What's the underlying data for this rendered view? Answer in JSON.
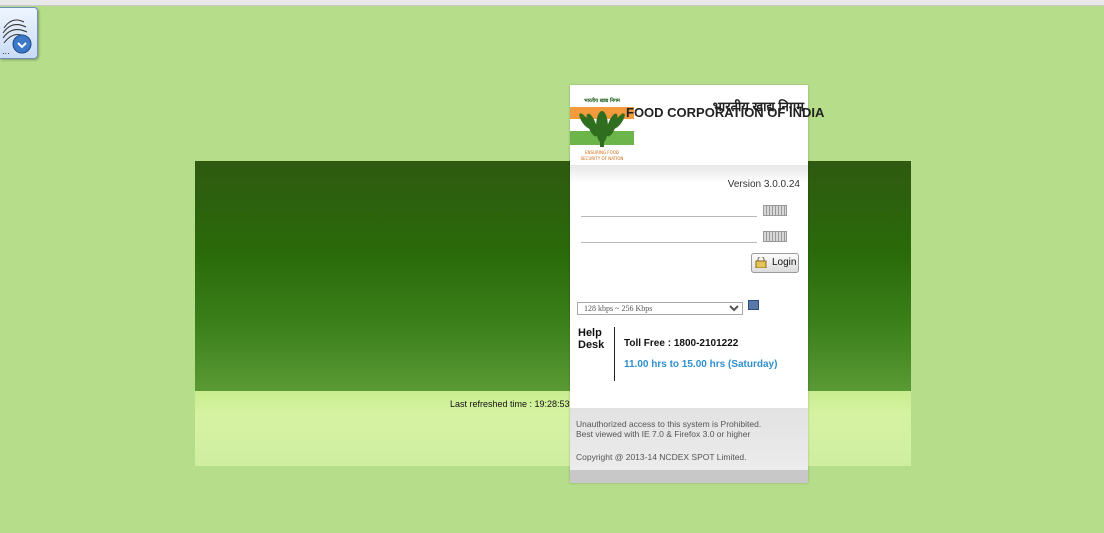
{
  "header": {
    "hindi_name": "भारतीय खाद्य निगम",
    "org_name": "FOOD CORPORATION OF INDIA",
    "logo_text": [
      "भारतीय खाद्य निगम",
      "ENSURING FOOD",
      "SECURITY OF NATION"
    ]
  },
  "login": {
    "version": "Version 3.0.0.24",
    "username_value": "",
    "password_value": "",
    "login_label": "Login"
  },
  "connection": {
    "speed_selected": "128 kbps ~ 256 Kbps"
  },
  "help": {
    "label_line1": "Help",
    "label_line2": "Desk",
    "toll_free": "Toll Free : 1800-2101222",
    "hours": "11.00 hrs to 15.00 hrs (Saturday)"
  },
  "footer": {
    "unauthorized": "Unauthorized access to this system is Prohibited.",
    "browser_note": "Best viewed with IE 7.0 & Firefox 3.0 or higher",
    "copyright": "Copyright @ 2013-14 NCDEX SPOT Limited."
  },
  "status": {
    "last_refreshed": "Last refreshed time : 19:28:53"
  },
  "colors": {
    "page_bg": "#b5dd8a",
    "band_dark": "#2a6a0a",
    "hours_blue": "#2f8fcf"
  }
}
